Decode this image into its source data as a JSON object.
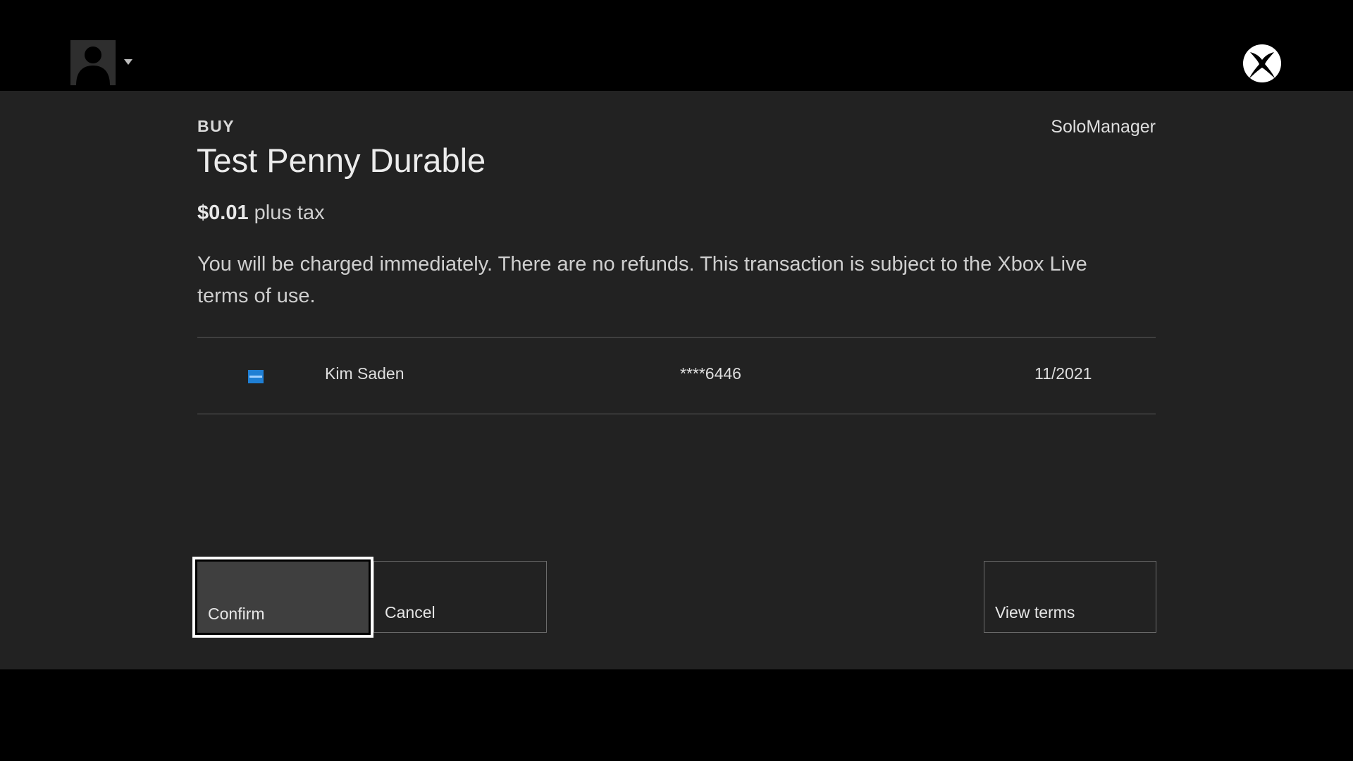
{
  "header": {
    "avatar_icon": "user-avatar-icon",
    "dropdown_icon": "caret-down-icon",
    "logo_icon": "xbox-logo-icon"
  },
  "purchase": {
    "action_label": "BUY",
    "account": "SoloManager",
    "title": "Test Penny Durable",
    "price": "$0.01",
    "price_suffix": "plus tax",
    "disclaimer": "You will be charged immediately. There are no refunds. This transaction is subject to the Xbox Live terms of use."
  },
  "payment": {
    "card_icon": "credit-card-icon",
    "card_color": "#1f7fd4",
    "name": "Kim Saden",
    "number": "****6446",
    "expiry": "11/2021"
  },
  "buttons": {
    "confirm": "Confirm",
    "cancel": "Cancel",
    "view_terms": "View terms"
  },
  "colors": {
    "background": "#000000",
    "panel": "#222222",
    "focus_border": "#ffffff",
    "focused_fill": "#3f3f3f"
  }
}
